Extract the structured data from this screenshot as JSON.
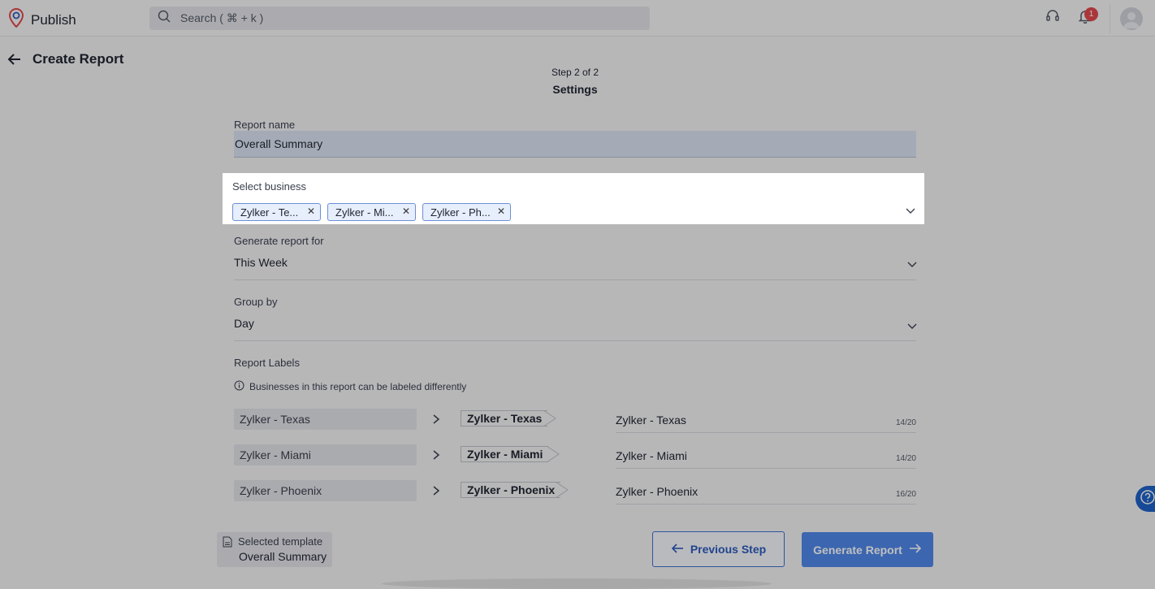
{
  "app": {
    "name": "Publish"
  },
  "search": {
    "placeholder": "Search ( ⌘ + k )"
  },
  "notifications": {
    "count": "1"
  },
  "page": {
    "title": "Create Report",
    "step": "Step 2 of 2",
    "step_title": "Settings"
  },
  "form": {
    "report_name_label": "Report name",
    "report_name_value": "Overall Summary",
    "select_business_label": "Select business",
    "selected_businesses": [
      "Zylker - Te...",
      "Zylker - Mi...",
      "Zylker - Ph..."
    ],
    "generate_for_label": "Generate report for",
    "generate_for_value": "This Week",
    "group_by_label": "Group by",
    "group_by_value": "Day",
    "report_labels_title": "Report Labels",
    "report_labels_info": "Businesses in this report can be labeled differently"
  },
  "labels": [
    {
      "source": "Zylker - Texas",
      "tag": "Zylker - Texas",
      "value": "Zylker - Texas",
      "count": "14/20"
    },
    {
      "source": "Zylker - Miami",
      "tag": "Zylker - Miami",
      "value": "Zylker - Miami",
      "count": "14/20"
    },
    {
      "source": "Zylker - Phoenix",
      "tag": "Zylker - Phoenix",
      "value": "Zylker - Phoenix",
      "count": "16/20"
    }
  ],
  "template": {
    "label": "Selected template",
    "value": "Overall Summary"
  },
  "buttons": {
    "previous": "Previous Step",
    "generate": "Generate Report"
  }
}
